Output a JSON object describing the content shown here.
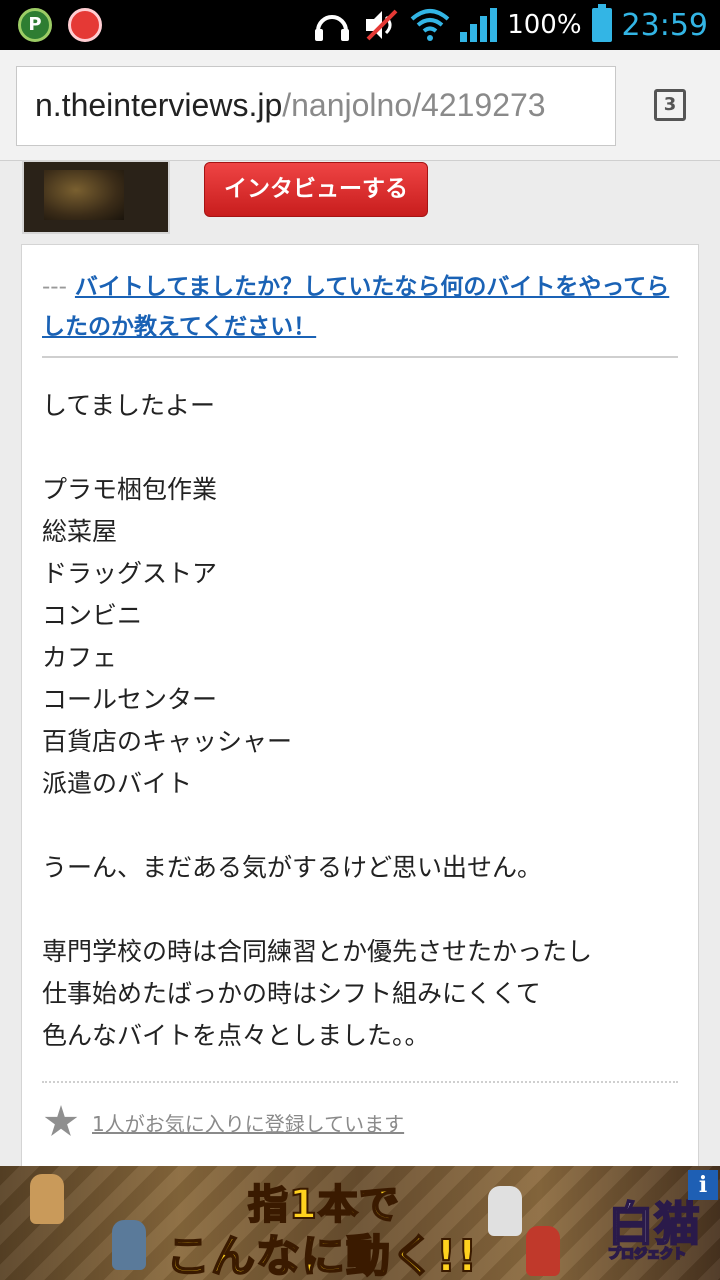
{
  "status_bar": {
    "battery_percent": "100%",
    "time": "23:59",
    "app_icons": [
      "p-app-icon",
      "red-app-icon"
    ],
    "system_icons": [
      "headphones-icon",
      "volume-muted-icon",
      "wifi-icon",
      "signal-icon",
      "battery-icon"
    ]
  },
  "browser": {
    "url_host": "n.theinterviews.jp",
    "url_path": "/nanjolno/4219273",
    "tab_count": "3"
  },
  "interview_button": {
    "label": "インタビューする"
  },
  "question": {
    "prefix": "---",
    "text": "バイトしてましたか？していたなら何のバイトをやってらしたのか教えてください！"
  },
  "answer_lines": [
    "してましたよー",
    "",
    "プラモ梱包作業",
    "総菜屋",
    "ドラッグストア",
    "コンビニ",
    "カフェ",
    "コールセンター",
    "百貨店のキャッシャー",
    "派遣のバイト",
    "",
    "うーん、まだある気がするけど思い出せん。",
    "",
    "専門学校の時は合同練習とか優先させたかったし",
    "仕事始めたばっかの時はシフト組みにくくて",
    "色んなバイトを点々としました。。"
  ],
  "favorites": {
    "text": "1人がお気に入りに登録しています",
    "icon": "star-icon"
  },
  "ad": {
    "line1": "指1本で",
    "line2": "こんなに動く!!",
    "logo": "白猫",
    "logo_sub": "プロジェクト",
    "info_label": "i"
  }
}
